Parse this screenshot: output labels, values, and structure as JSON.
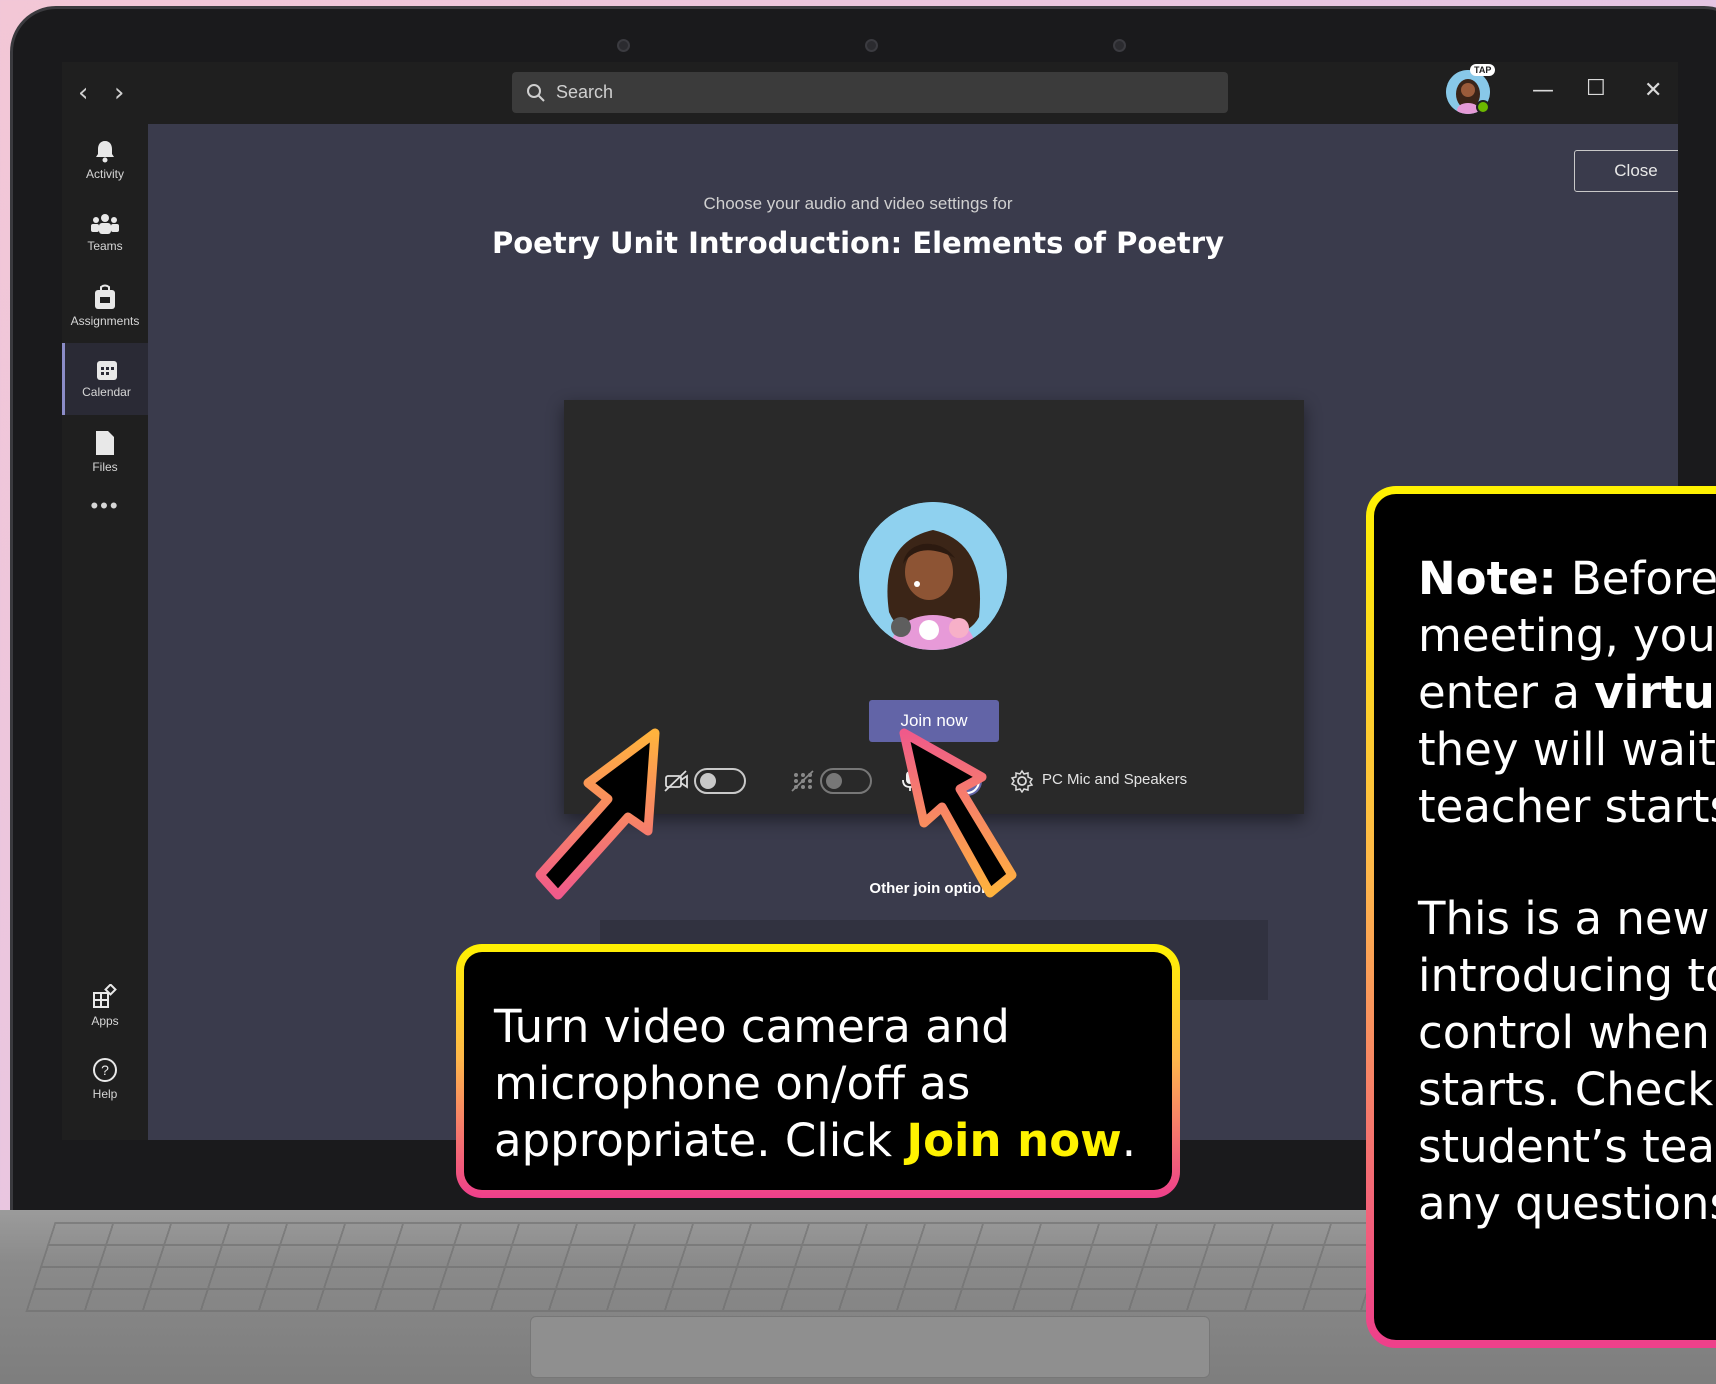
{
  "window": {
    "search_placeholder": "Search",
    "profile_badge": "TAP"
  },
  "rail": {
    "items": [
      {
        "label": "Activity",
        "icon": "bell-icon"
      },
      {
        "label": "Teams",
        "icon": "teams-icon"
      },
      {
        "label": "Assignments",
        "icon": "assignments-icon"
      },
      {
        "label": "Calendar",
        "icon": "calendar-icon"
      },
      {
        "label": "Files",
        "icon": "file-icon"
      },
      {
        "label": "Apps",
        "icon": "apps-icon"
      },
      {
        "label": "Help",
        "icon": "help-icon"
      }
    ],
    "active": "Calendar"
  },
  "main": {
    "close_label": "Close",
    "subtitle": "Choose your audio and video settings for",
    "meeting_title": "Poetry Unit Introduction: Elements of Poetry",
    "join_label": "Join now",
    "device_label": "PC Mic and Speakers",
    "other_options_label": "Other join options",
    "camera_on": false,
    "blur_on": false,
    "mic_on": true
  },
  "callouts": {
    "bottom": {
      "text": "Turn video camera and microphone on/off as appropriate. Click ",
      "highlight": "Join now",
      "end": "."
    },
    "right": {
      "line1_bold": "Note:",
      "line1_rest": " Before j",
      "line2": "meeting, your",
      "line3_pre": "enter a ",
      "line3_bold": "virtual",
      "line4": "they will wait u",
      "line5": "teacher starts t",
      "p2_line1": "This is a new fe",
      "p2_line2": "introducing to",
      "p2_line3": "control when t",
      "p2_line4": "starts. Check w",
      "p2_line5": "student’s teach",
      "p2_line6": "any questions."
    }
  }
}
